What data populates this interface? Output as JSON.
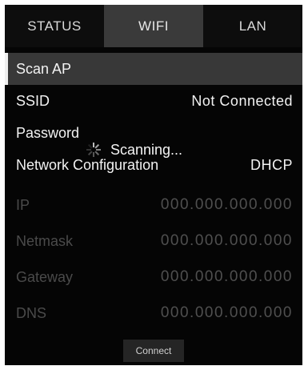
{
  "tabs": [
    {
      "label": "STATUS"
    },
    {
      "label": "WIFI"
    },
    {
      "label": "LAN"
    }
  ],
  "menu": {
    "scan_ap": "Scan AP",
    "ssid_label": "SSID",
    "ssid_value": "Not Connected",
    "password_label": "Password",
    "network_config_label": "Network Configuration",
    "network_config_value": "DHCP",
    "ip_label": "IP",
    "ip_value": "000.000.000.000",
    "netmask_label": "Netmask",
    "netmask_value": "000.000.000.000",
    "gateway_label": "Gateway",
    "gateway_value": "000.000.000.000",
    "dns_label": "DNS",
    "dns_value": "000.000.000.000"
  },
  "overlay": {
    "text": "Scanning..."
  },
  "actions": {
    "connect_label": "Connect"
  },
  "colors": {
    "background": "#050505",
    "active_tab": "#3a3a3a",
    "selected_row": "#383838",
    "text": "#f2f2f2",
    "disabled_text": "#4a4a4a"
  }
}
